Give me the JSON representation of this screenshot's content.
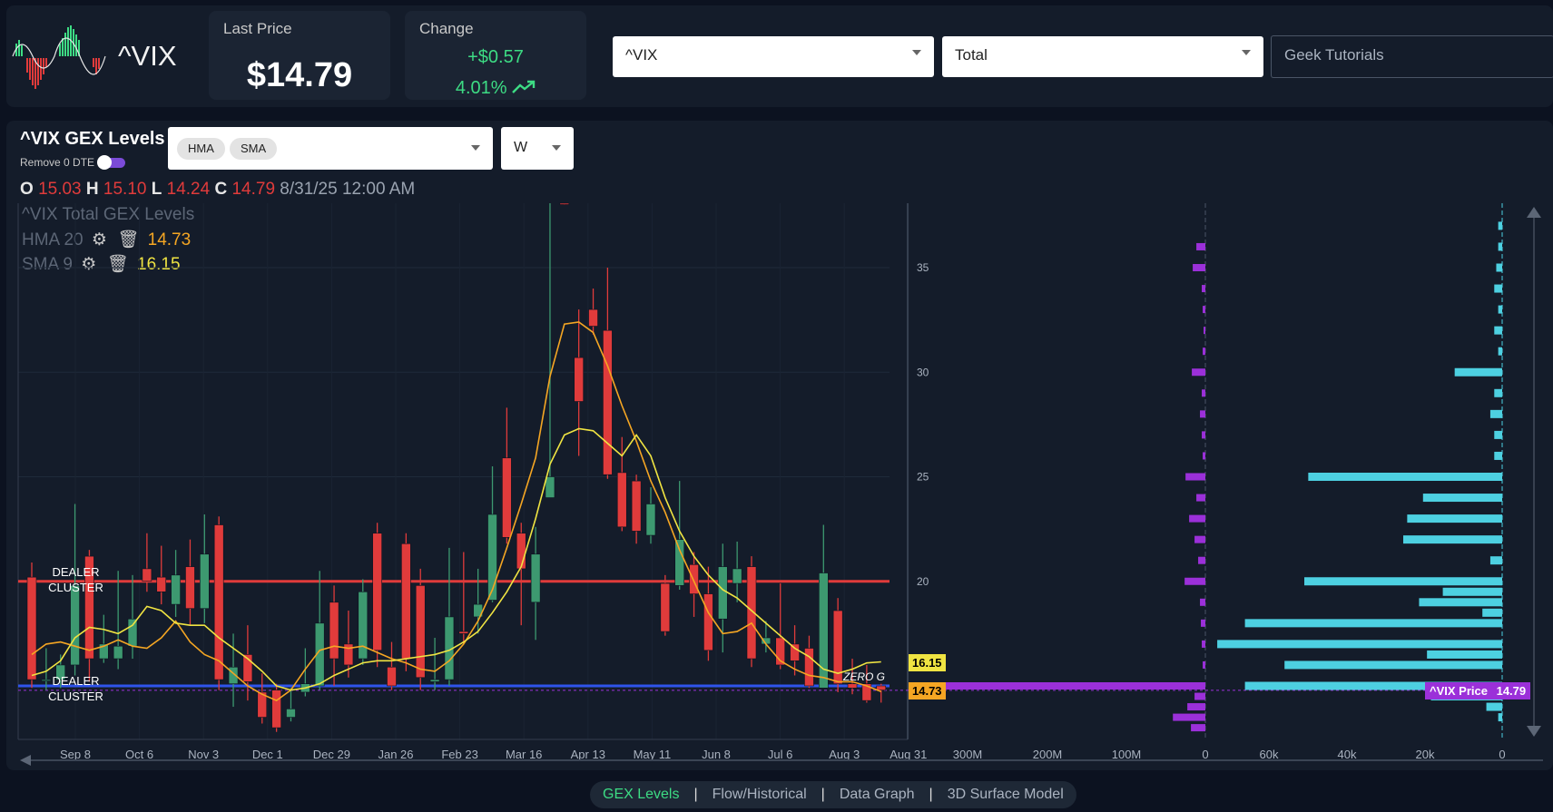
{
  "header": {
    "ticker": "^VIX",
    "last_price_label": "Last Price",
    "last_price": "$14.79",
    "change_label": "Change",
    "change_amount": "+$0.57",
    "change_pct": "4.01%"
  },
  "selects": {
    "symbol": "^VIX",
    "gex_type": "Total",
    "tutorials": "Geek Tutorials",
    "indicators": [
      "HMA",
      "SMA"
    ],
    "timeframe": "W"
  },
  "chart_panel": {
    "title": "^VIX GEX Levels",
    "toggle_label": "Remove 0 DTE",
    "ohlc": {
      "o_label": "O",
      "o": "15.03",
      "h_label": "H",
      "h": "15.10",
      "l_label": "L",
      "l": "14.24",
      "c_label": "C",
      "c": "14.79",
      "date": "8/31/25 12:00 AM"
    },
    "legend_title": "^VIX Total GEX Levels",
    "hma": {
      "name": "HMA",
      "period": "20",
      "value": "14.73"
    },
    "sma": {
      "name": "SMA",
      "period": "9",
      "value": "16.15"
    },
    "annotations": {
      "dealer_cluster_top": "DEALER CLUSTER",
      "dealer_cluster_bottom": "DEALER CLUSTER",
      "zero_g": "ZERO G"
    },
    "badges": {
      "sma_badge": "16.15",
      "hma_badge": "14.73",
      "price_badge_label": "^VIX Price",
      "price_badge_value": "14.79"
    }
  },
  "colors": {
    "up": "#3d9970",
    "down": "#e03b3b",
    "hma": "#f5a623",
    "sma": "#f0e442",
    "dealer_red": "#e03b3b",
    "dealer_blue": "#2f54eb",
    "gex_purple": "#9b30d9",
    "oi_cyan": "#4dd0e1",
    "positive_green": "#3ddc84"
  },
  "chart_data": {
    "type": "candlestick",
    "x_ticks": [
      "Sep 8",
      "Oct 6",
      "Nov 3",
      "Dec 1",
      "Dec 29",
      "Jan 26",
      "Feb 23",
      "Mar 16",
      "Apr 13",
      "May 11",
      "Jun 8",
      "Jul 6",
      "Aug 3",
      "Aug 31"
    ],
    "y_ticks": [
      20,
      25,
      30,
      35
    ],
    "ylim": [
      13,
      38.5
    ],
    "levels": {
      "dealer_cluster_top": 20,
      "dealer_cluster_bottom": 15.0,
      "zero_g": 15.1
    },
    "candles": [
      [
        20.2,
        15.3,
        20.9,
        14.9
      ],
      [
        15.3,
        15.3,
        16.8,
        14.8
      ],
      [
        15.3,
        16.0,
        16.5,
        14.9
      ],
      [
        16.0,
        19.8,
        23.7,
        15.5
      ],
      [
        21.2,
        16.3,
        21.5,
        15.2
      ],
      [
        16.3,
        17.0,
        18.4,
        16.1
      ],
      [
        16.3,
        16.9,
        20.5,
        15.8
      ],
      [
        16.9,
        18.2,
        20.3,
        16.3
      ],
      [
        20.6,
        20.0,
        22.3,
        19.5
      ],
      [
        20.2,
        19.5,
        21.7,
        18.9
      ],
      [
        18.9,
        20.3,
        21.5,
        18.3
      ],
      [
        20.7,
        18.7,
        22.0,
        17.9
      ],
      [
        18.7,
        21.3,
        23.2,
        18.0
      ],
      [
        22.7,
        15.3,
        23.1,
        14.8
      ],
      [
        15.1,
        15.9,
        17.5,
        14.0
      ],
      [
        16.5,
        15.2,
        17.9,
        14.3
      ],
      [
        14.7,
        13.5,
        15.6,
        13.2
      ],
      [
        14.8,
        13.0,
        15.1,
        12.8
      ],
      [
        13.5,
        13.9,
        14.9,
        13.3
      ],
      [
        14.7,
        15.1,
        16.8,
        14.5
      ],
      [
        15.0,
        18.0,
        20.5,
        14.8
      ],
      [
        19.0,
        16.3,
        19.8,
        15.0
      ],
      [
        17.0,
        16.0,
        18.6,
        15.4
      ],
      [
        16.3,
        19.5,
        20.1,
        16.0
      ],
      [
        22.3,
        16.7,
        22.8,
        15.9
      ],
      [
        15.9,
        15.0,
        17.1,
        14.8
      ],
      [
        21.8,
        16.3,
        22.3,
        15.7
      ],
      [
        19.8,
        15.4,
        20.6,
        14.8
      ],
      [
        15.2,
        15.3,
        17.3,
        14.8
      ],
      [
        15.3,
        18.3,
        21.6,
        15.0
      ],
      [
        17.6,
        17.5,
        21.4,
        17.0
      ],
      [
        18.3,
        18.9,
        20.6,
        17.5
      ],
      [
        19.1,
        23.2,
        25.5,
        19.0
      ],
      [
        25.9,
        22.1,
        28.3,
        21.8
      ],
      [
        22.3,
        20.6,
        22.8,
        17.9
      ],
      [
        19.0,
        21.3,
        22.6,
        17.2
      ],
      [
        24.0,
        25.0,
        52.3,
        24.5
      ],
      [
        45.3,
        38.5,
        46.9,
        38.0
      ],
      [
        30.7,
        28.6,
        33.0,
        26.0
      ],
      [
        33.0,
        32.2,
        34.0,
        31.8
      ],
      [
        32.0,
        25.1,
        35.0,
        24.9
      ],
      [
        25.2,
        22.6,
        26.9,
        22.4
      ],
      [
        24.8,
        22.4,
        25.1,
        21.8
      ],
      [
        22.2,
        23.7,
        24.5,
        21.8
      ],
      [
        19.9,
        17.6,
        20.3,
        17.4
      ],
      [
        19.8,
        22.0,
        24.8,
        19.6
      ],
      [
        20.8,
        19.4,
        21.4,
        18.3
      ],
      [
        19.4,
        16.7,
        20.7,
        16.2
      ],
      [
        18.2,
        20.7,
        21.8,
        16.6
      ],
      [
        19.9,
        20.6,
        21.9,
        19.0
      ],
      [
        20.7,
        16.3,
        21.2,
        15.9
      ],
      [
        17.0,
        17.3,
        18.1,
        16.6
      ],
      [
        17.3,
        16.0,
        19.9,
        15.8
      ],
      [
        17.0,
        16.2,
        17.9,
        15.5
      ],
      [
        16.8,
        15.0,
        17.4,
        14.9
      ],
      [
        14.9,
        20.4,
        22.7,
        14.9
      ],
      [
        18.6,
        15.1,
        19.2,
        14.7
      ],
      [
        15.1,
        14.9,
        16.3,
        14.6
      ],
      [
        15.1,
        14.3,
        16.0,
        14.2
      ],
      [
        15.0,
        14.8,
        15.1,
        14.2
      ]
    ],
    "hma": [
      16.5,
      17.0,
      17.1,
      16.9,
      16.7,
      16.9,
      17.2,
      16.9,
      16.8,
      17.3,
      18.1,
      17.1,
      16.5,
      16.2,
      15.6,
      15.0,
      14.6,
      14.3,
      14.8,
      15.8,
      16.7,
      16.9,
      16.8,
      16.9,
      16.6,
      16.3,
      16.1,
      15.8,
      15.7,
      16.2,
      17.0,
      18.1,
      19.6,
      21.6,
      23.7,
      25.9,
      29.8,
      32.3,
      32.4,
      31.9,
      30.3,
      28.4,
      26.7,
      24.8,
      23.3,
      21.5,
      20.0,
      18.5,
      17.5,
      17.6,
      18.0,
      17.0,
      16.2,
      15.8,
      15.5,
      15.4,
      15.2,
      15.2,
      15.0,
      14.73
    ],
    "sma": [
      15.5,
      15.7,
      16.2,
      17.3,
      17.8,
      17.7,
      17.5,
      17.9,
      18.8,
      18.6,
      18.0,
      17.9,
      17.9,
      17.3,
      16.8,
      16.3,
      15.7,
      15.0,
      14.8,
      14.9,
      15.1,
      15.5,
      15.8,
      16.1,
      16.2,
      16.2,
      16.3,
      16.4,
      16.5,
      16.7,
      17.1,
      17.6,
      18.5,
      19.5,
      20.7,
      23.0,
      25.6,
      27.0,
      27.3,
      27.2,
      26.6,
      26.0,
      27.0,
      26.0,
      24.0,
      22.4,
      21.2,
      20.3,
      19.6,
      19.2,
      18.6,
      18.0,
      17.4,
      16.8,
      16.4,
      15.8,
      15.6,
      15.8,
      16.1,
      16.15
    ],
    "gex_axis": {
      "ticks": [
        "300M",
        "200M",
        "100M",
        "0"
      ],
      "max": 300
    },
    "gex_bars": [
      [
        36.0,
        10
      ],
      [
        35.0,
        14
      ],
      [
        34.0,
        4
      ],
      [
        33.0,
        3
      ],
      [
        32.0,
        2
      ],
      [
        31.0,
        3
      ],
      [
        30.0,
        15
      ],
      [
        29.0,
        4
      ],
      [
        28.0,
        6
      ],
      [
        27.0,
        4
      ],
      [
        26.0,
        3
      ],
      [
        25.0,
        22
      ],
      [
        24.0,
        10
      ],
      [
        23.0,
        18
      ],
      [
        22.0,
        12
      ],
      [
        21.0,
        8
      ],
      [
        20.0,
        23
      ],
      [
        19.0,
        6
      ],
      [
        18.0,
        5
      ],
      [
        17.0,
        4
      ],
      [
        16.0,
        3
      ],
      [
        15.0,
        320
      ],
      [
        14.5,
        12
      ],
      [
        14.0,
        20
      ],
      [
        13.5,
        36
      ],
      [
        13.0,
        16
      ]
    ],
    "oi_axis": {
      "ticks": [
        "60k",
        "40k",
        "20k",
        "0"
      ],
      "max": 75
    },
    "oi_bars": [
      [
        37.0,
        1
      ],
      [
        36.0,
        1
      ],
      [
        35.0,
        1.5
      ],
      [
        34.0,
        2
      ],
      [
        33.0,
        1
      ],
      [
        32.0,
        2
      ],
      [
        31.0,
        1
      ],
      [
        30.0,
        12
      ],
      [
        29.0,
        2
      ],
      [
        28.0,
        3
      ],
      [
        27.0,
        2
      ],
      [
        26.0,
        2
      ],
      [
        25.0,
        49
      ],
      [
        24.0,
        20
      ],
      [
        23.0,
        24
      ],
      [
        22.0,
        25
      ],
      [
        21.0,
        3
      ],
      [
        20.0,
        50
      ],
      [
        19.5,
        15
      ],
      [
        19.0,
        21
      ],
      [
        18.5,
        5
      ],
      [
        18.0,
        65
      ],
      [
        17.0,
        72
      ],
      [
        16.5,
        19
      ],
      [
        16.0,
        55
      ],
      [
        15.0,
        65
      ],
      [
        14.5,
        18
      ],
      [
        14.0,
        4
      ],
      [
        13.5,
        1
      ]
    ]
  },
  "bottom_nav": [
    "GEX Levels",
    "Flow/Historical",
    "Data Graph",
    "3D Surface Model"
  ]
}
